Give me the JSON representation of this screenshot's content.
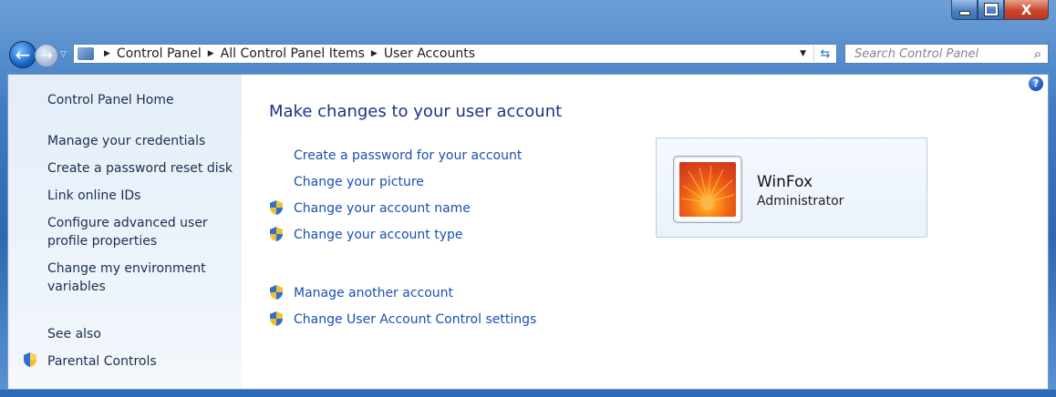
{
  "window": {
    "caption_buttons": {
      "close_label": "X"
    }
  },
  "address_bar": {
    "breadcrumbs": [
      "Control Panel",
      "All Control Panel Items",
      "User Accounts"
    ]
  },
  "search": {
    "placeholder": "Search Control Panel"
  },
  "sidebar": {
    "home": "Control Panel Home",
    "tasks": [
      "Manage your credentials",
      "Create a password reset disk",
      "Link online IDs",
      "Configure advanced user profile properties",
      "Change my environment variables"
    ],
    "see_also_label": "See also",
    "see_also": [
      "Parental Controls"
    ]
  },
  "main": {
    "heading": "Make changes to your user account",
    "links": [
      "Create a password for your account",
      "Change your picture",
      "Change your account name",
      "Change your account type"
    ],
    "other_links": [
      "Manage another account",
      "Change User Account Control settings"
    ]
  },
  "account": {
    "name": "WinFox",
    "role": "Administrator"
  },
  "colors": {
    "link": "#1a4fb0",
    "heading": "#1e3287",
    "sidebar_bg": "#e5eef9"
  }
}
